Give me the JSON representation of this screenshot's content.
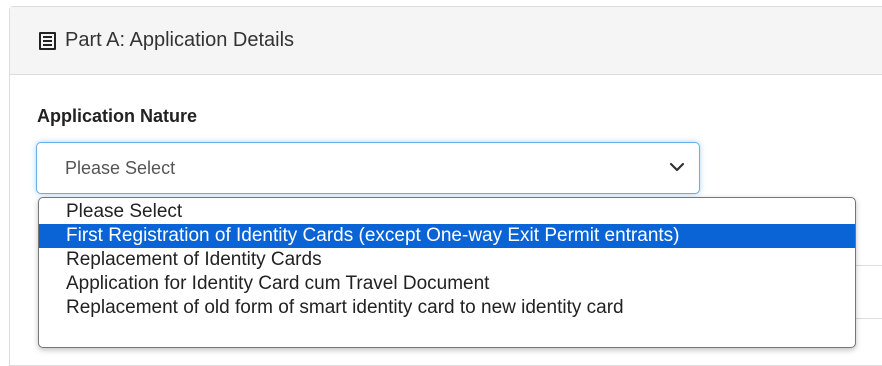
{
  "panel": {
    "title": "Part A: Application Details",
    "title_icon": "list-alt-icon"
  },
  "field": {
    "label": "Application Nature",
    "selected_value": "Please Select"
  },
  "dropdown": {
    "options": [
      "Please Select",
      "First Registration of Identity Cards (except One-way Exit Permit entrants)",
      "Replacement of Identity Cards",
      "Application for Identity Card cum Travel Document",
      "Replacement of old form of smart identity card to new identity card"
    ],
    "highlighted_index": 1
  },
  "colors": {
    "highlight": "#0a64d6",
    "focus_border": "#66afe9"
  }
}
